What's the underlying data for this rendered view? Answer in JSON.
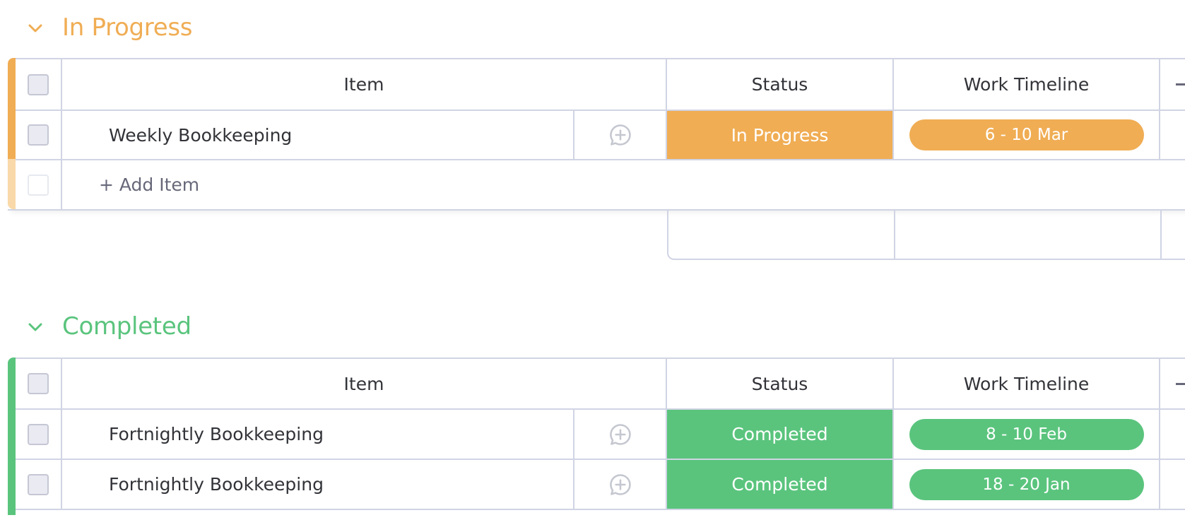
{
  "columns": {
    "item": "Item",
    "status": "Status",
    "timeline": "Work Timeline"
  },
  "groups": [
    {
      "title": "In Progress",
      "color": "#f0ad54",
      "color_light": "#f9d9a9",
      "rows": [
        {
          "name": "Weekly Bookkeeping",
          "status": "In Progress",
          "timeline": "6 - 10 Mar"
        }
      ],
      "add_item_label": "+ Add Item"
    },
    {
      "title": "Completed",
      "color": "#5ac47d",
      "rows": [
        {
          "name": "Fortnightly Bookkeeping",
          "status": "Completed",
          "timeline": "8 - 10 Feb"
        },
        {
          "name": "Fortnightly Bookkeeping",
          "status": "Completed",
          "timeline": "18 - 20 Jan"
        }
      ]
    }
  ],
  "icons": {
    "collapse": "chevron-down-icon",
    "comment": "add-update-icon",
    "add_column": "plus-icon"
  }
}
